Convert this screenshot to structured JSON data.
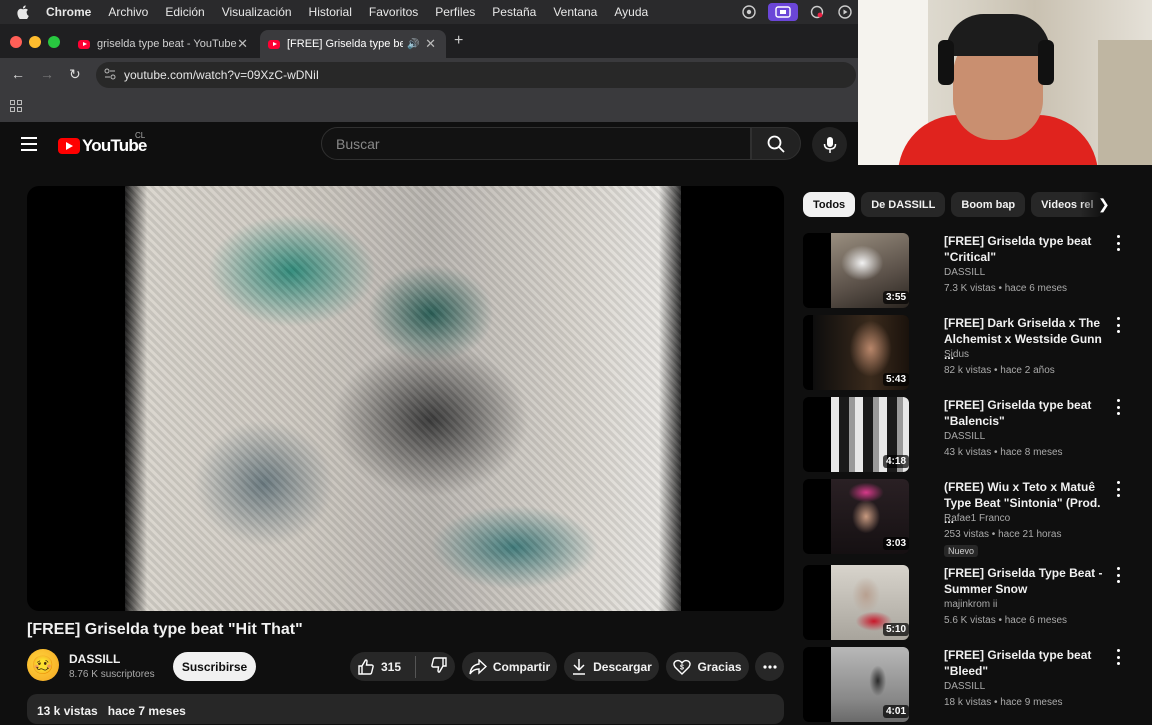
{
  "menubar": {
    "items": [
      "Chrome",
      "Archivo",
      "Edición",
      "Visualización",
      "Historial",
      "Favoritos",
      "Perfiles",
      "Pestaña",
      "Ventana",
      "Ayuda"
    ]
  },
  "tabs": [
    {
      "title": "griselda type beat - YouTube"
    },
    {
      "title": "[FREE] Griselda type beat"
    }
  ],
  "omnibox": {
    "url": "youtube.com/watch?v=09XzC-wDNiI"
  },
  "youtube": {
    "logo": "YouTube",
    "region": "CL",
    "search_placeholder": "Buscar"
  },
  "video": {
    "title": "[FREE] Griselda type beat \"Hit That\"",
    "channel": "DASSILL",
    "subscribers": "8.76 K suscriptores",
    "subscribe_label": "Suscribirse",
    "likes": "315",
    "share_label": "Compartir",
    "download_label": "Descargar",
    "thanks_label": "Gracias",
    "views": "13 k vistas",
    "age": "hace 7 meses"
  },
  "chips": [
    "Todos",
    "De DASSILL",
    "Boom bap",
    "Videos rel"
  ],
  "recommendations": [
    {
      "title": "[FREE] Griselda type beat \"Critical\"",
      "channel": "DASSILL",
      "meta": "7.3 K vistas • hace 6 meses",
      "duration": "3:55",
      "badge": ""
    },
    {
      "title": "[FREE] Dark Griselda x The Alchemist x Westside Gunn ...",
      "channel": "Sidus",
      "meta": "82 k vistas • hace 2 años",
      "duration": "5:43",
      "badge": ""
    },
    {
      "title": "[FREE] Griselda type beat \"Balencis\"",
      "channel": "DASSILL",
      "meta": "43 k vistas • hace 8 meses",
      "duration": "4:18",
      "badge": ""
    },
    {
      "title": "(FREE) Wiu x Teto x Matuê  Type Beat \"Sintonia\" (Prod. ...",
      "channel": "Rafae1 Franco",
      "meta": "253 vistas • hace 21 horas",
      "duration": "3:03",
      "badge": "Nuevo"
    },
    {
      "title": "[FREE] Griselda Type Beat - Summer Snow",
      "channel": "majinkrom ii",
      "meta": "5.6 K vistas • hace 6 meses",
      "duration": "5:10",
      "badge": ""
    },
    {
      "title": "[FREE] Griselda type beat \"Bleed\"",
      "channel": "DASSILL",
      "meta": "18 k vistas • hace 9 meses",
      "duration": "4:01",
      "badge": ""
    }
  ],
  "colors": {
    "accent": "#ff0000",
    "background": "#0f0f0f",
    "pill": "#272727"
  }
}
